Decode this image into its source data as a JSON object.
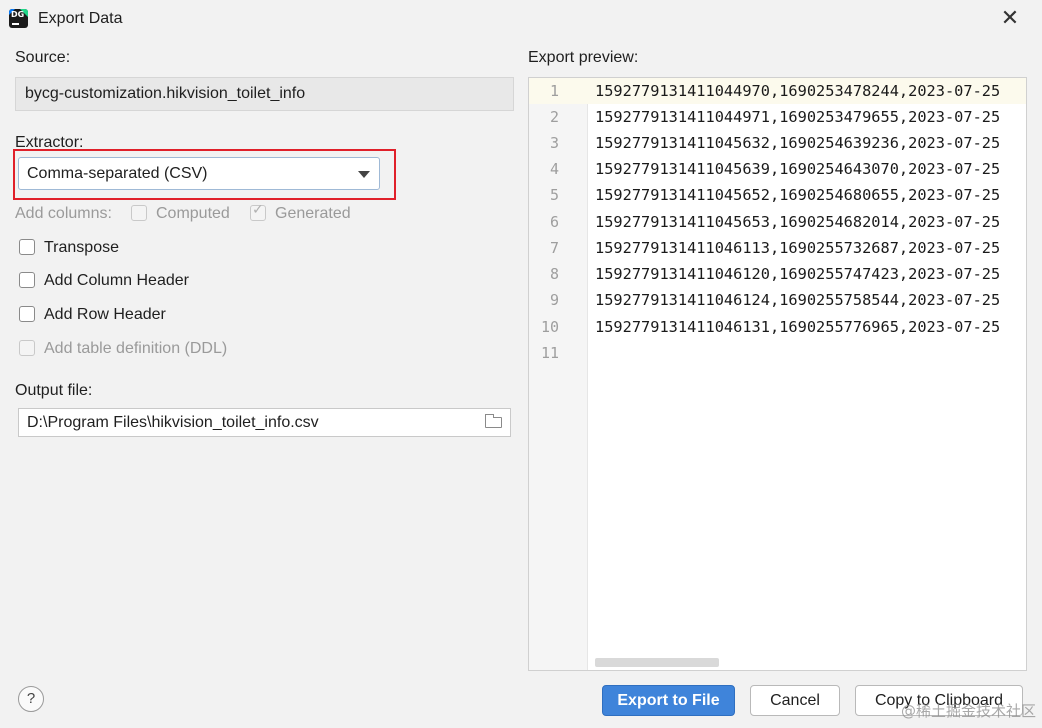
{
  "window": {
    "title": "Export Data",
    "close_glyph": "✕"
  },
  "source": {
    "label": "Source:",
    "value": "bycg-customization.hikvision_toilet_info"
  },
  "extractor": {
    "label": "Extractor:",
    "selected": "Comma-separated (CSV)"
  },
  "add_columns": {
    "label": "Add columns:",
    "computed": {
      "label": "Computed",
      "checked": false,
      "enabled": false
    },
    "generated": {
      "label": "Generated",
      "checked": true,
      "enabled": false
    }
  },
  "options": [
    {
      "label": "Transpose",
      "checked": false,
      "enabled": true
    },
    {
      "label": "Add Column Header",
      "checked": false,
      "enabled": true
    },
    {
      "label": "Add Row Header",
      "checked": false,
      "enabled": true
    },
    {
      "label": "Add table definition (DDL)",
      "checked": false,
      "enabled": false
    }
  ],
  "output": {
    "label": "Output file:",
    "value": "D:\\Program Files\\hikvision_toilet_info.csv"
  },
  "preview": {
    "label": "Export preview:",
    "lines": [
      {
        "n": "1",
        "text": "1592779131411044970,1690253478244,2023-07-25"
      },
      {
        "n": "2",
        "text": "1592779131411044971,1690253479655,2023-07-25"
      },
      {
        "n": "3",
        "text": "1592779131411045632,1690254639236,2023-07-25"
      },
      {
        "n": "4",
        "text": "1592779131411045639,1690254643070,2023-07-25"
      },
      {
        "n": "5",
        "text": "1592779131411045652,1690254680655,2023-07-25"
      },
      {
        "n": "6",
        "text": "1592779131411045653,1690254682014,2023-07-25"
      },
      {
        "n": "7",
        "text": "1592779131411046113,1690255732687,2023-07-25"
      },
      {
        "n": "8",
        "text": "1592779131411046120,1690255747423,2023-07-25"
      },
      {
        "n": "9",
        "text": "1592779131411046124,1690255758544,2023-07-25"
      },
      {
        "n": "10",
        "text": "1592779131411046131,1690255776965,2023-07-25"
      },
      {
        "n": "11",
        "text": ""
      }
    ]
  },
  "buttons": {
    "help": "?",
    "export": "Export to File",
    "cancel": "Cancel",
    "copy": "Copy to Clipboard"
  },
  "watermark": "@稀土掘金技术社区",
  "colors": {
    "accent": "#3f84da",
    "highlight_border": "#e0202a"
  }
}
